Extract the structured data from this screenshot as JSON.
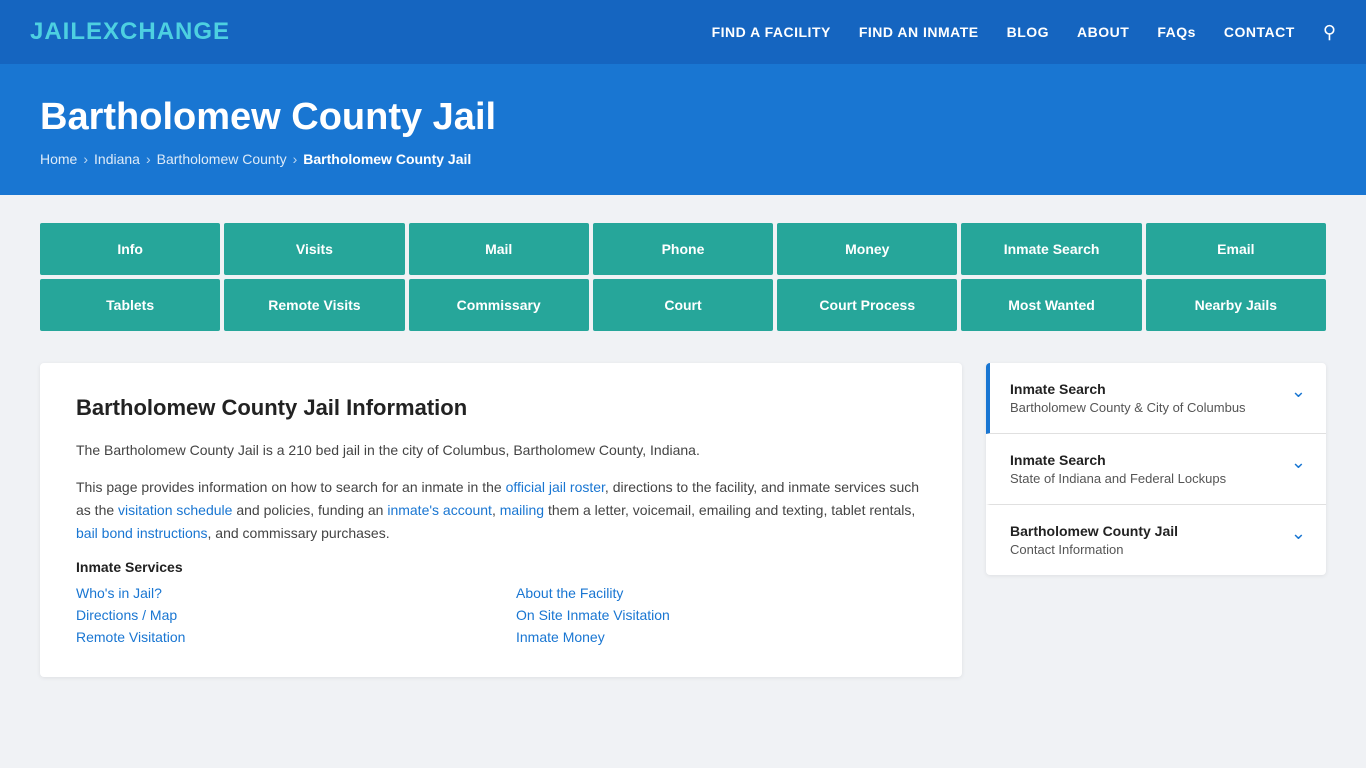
{
  "header": {
    "logo_jail": "JAIL",
    "logo_exchange": "EXCHANGE",
    "nav": [
      {
        "label": "FIND A FACILITY",
        "href": "#"
      },
      {
        "label": "FIND AN INMATE",
        "href": "#"
      },
      {
        "label": "BLOG",
        "href": "#"
      },
      {
        "label": "ABOUT",
        "href": "#"
      },
      {
        "label": "FAQs",
        "href": "#"
      },
      {
        "label": "CONTACT",
        "href": "#"
      }
    ]
  },
  "hero": {
    "title": "Bartholomew County Jail",
    "breadcrumb": [
      {
        "label": "Home",
        "href": "#"
      },
      {
        "label": "Indiana",
        "href": "#"
      },
      {
        "label": "Bartholomew County",
        "href": "#"
      },
      {
        "label": "Bartholomew County Jail",
        "current": true
      }
    ]
  },
  "tabs_row1": [
    {
      "label": "Info"
    },
    {
      "label": "Visits"
    },
    {
      "label": "Mail"
    },
    {
      "label": "Phone"
    },
    {
      "label": "Money"
    },
    {
      "label": "Inmate Search"
    },
    {
      "label": "Email"
    }
  ],
  "tabs_row2": [
    {
      "label": "Tablets"
    },
    {
      "label": "Remote Visits"
    },
    {
      "label": "Commissary"
    },
    {
      "label": "Court"
    },
    {
      "label": "Court Process"
    },
    {
      "label": "Most Wanted"
    },
    {
      "label": "Nearby Jails"
    }
  ],
  "main": {
    "left": {
      "heading": "Bartholomew County Jail Information",
      "para1": "The Bartholomew County Jail is a 210 bed jail in the city of Columbus, Bartholomew County, Indiana.",
      "para2_before": "This page provides information on how to search for an inmate in the ",
      "para2_link1_text": "official jail roster",
      "para2_mid": ", directions to the facility, and inmate services such as the ",
      "para2_link2_text": "visitation schedule",
      "para2_mid2": " and policies, funding an ",
      "para2_link3_text": "inmate's account",
      "para2_sep1": ", ",
      "para2_link4_text": "mailing",
      "para2_tail": " them a letter, voicemail, emailing and texting, tablet rentals, ",
      "para2_link5_text": "bail bond instructions",
      "para2_tail2": ", and commissary purchases.",
      "services_heading": "Inmate Services",
      "services": [
        {
          "label": "Who's in Jail?",
          "col": 1
        },
        {
          "label": "About the Facility",
          "col": 2
        },
        {
          "label": "Directions / Map",
          "col": 1
        },
        {
          "label": "On Site Inmate Visitation",
          "col": 2
        },
        {
          "label": "Remote Visitation",
          "col": 1
        },
        {
          "label": "Inmate Money",
          "col": 2
        }
      ]
    },
    "right": [
      {
        "title": "Inmate Search",
        "subtitle": "Bartholomew County & City of Columbus",
        "active": true
      },
      {
        "title": "Inmate Search",
        "subtitle": "State of Indiana and Federal Lockups",
        "active": false
      },
      {
        "title": "Bartholomew County Jail",
        "subtitle": "Contact Information",
        "active": false
      }
    ]
  }
}
